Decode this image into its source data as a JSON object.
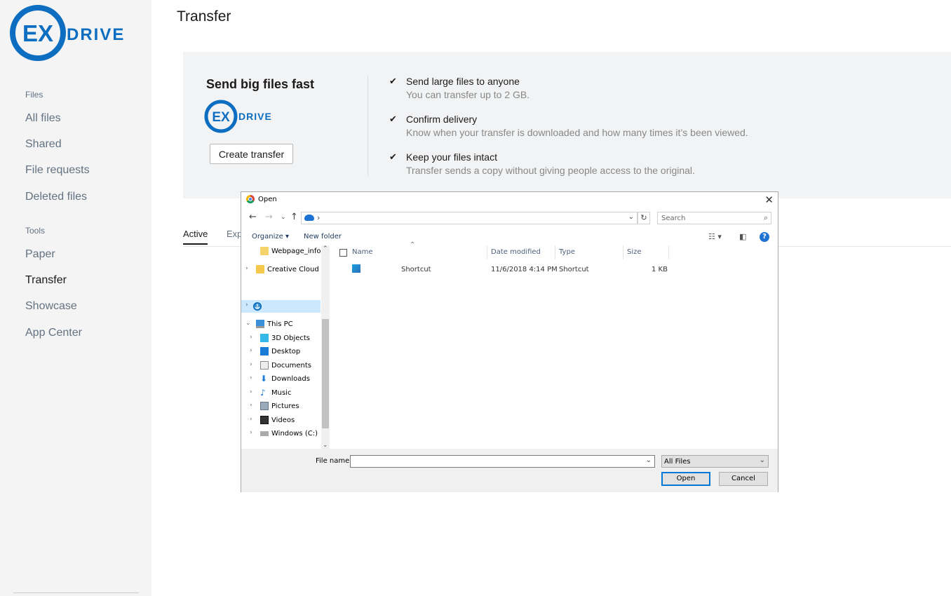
{
  "brand": {
    "logo_mark": "EX",
    "logo_word": "DRIVE",
    "color": "#0d6ec1"
  },
  "sidebar": {
    "files_heading": "Files",
    "files_items": [
      {
        "label": "All files"
      },
      {
        "label": "Shared"
      },
      {
        "label": "File requests"
      },
      {
        "label": "Deleted files"
      }
    ],
    "tools_heading": "Tools",
    "tools_items": [
      {
        "label": "Paper"
      },
      {
        "label": "Transfer",
        "active": true
      },
      {
        "label": "Showcase"
      },
      {
        "label": "App Center"
      }
    ]
  },
  "page": {
    "title": "Transfer"
  },
  "banner": {
    "title": "Send big files fast",
    "create_button": "Create transfer",
    "features": [
      {
        "title": "Send large files to anyone",
        "desc": "You can transfer up to 2 GB."
      },
      {
        "title": "Confirm delivery",
        "desc": "Know when your transfer is downloaded and how many times it’s been viewed."
      },
      {
        "title": "Keep your files intact",
        "desc": "Transfer sends a copy without giving people access to the original."
      }
    ]
  },
  "tabs": {
    "active": "Active",
    "expired": "Exp"
  },
  "dialog": {
    "title": "Open",
    "search_placeholder": "Search",
    "organize": "Organize ▾",
    "new_folder": "New folder",
    "tree": [
      {
        "label": "Webpage_info_f",
        "icon": "folder-icon"
      },
      {
        "label": "Creative Cloud Fil",
        "icon": "creative-cloud-icon"
      },
      {
        "label": "",
        "icon": "exdrive-icon",
        "selected": true
      },
      {
        "label": "This PC",
        "icon": "pc-icon"
      },
      {
        "label": "3D Objects",
        "icon": "3d-objects-icon"
      },
      {
        "label": "Desktop",
        "icon": "desktop-icon"
      },
      {
        "label": "Documents",
        "icon": "documents-icon"
      },
      {
        "label": "Downloads",
        "icon": "downloads-icon"
      },
      {
        "label": "Music",
        "icon": "music-icon"
      },
      {
        "label": "Pictures",
        "icon": "pictures-icon"
      },
      {
        "label": "Videos",
        "icon": "videos-icon"
      },
      {
        "label": "Windows (C:)",
        "icon": "drive-icon"
      }
    ],
    "columns": {
      "name": "Name",
      "date": "Date modified",
      "type": "Type",
      "size": "Size"
    },
    "files": [
      {
        "name": "Shortcut",
        "date": "11/6/2018 4:14 PM",
        "type": "Shortcut",
        "size": "1 KB"
      }
    ],
    "file_name_label": "File name:",
    "file_name_value": "",
    "filter": "All Files",
    "open_button": "Open",
    "cancel_button": "Cancel"
  }
}
